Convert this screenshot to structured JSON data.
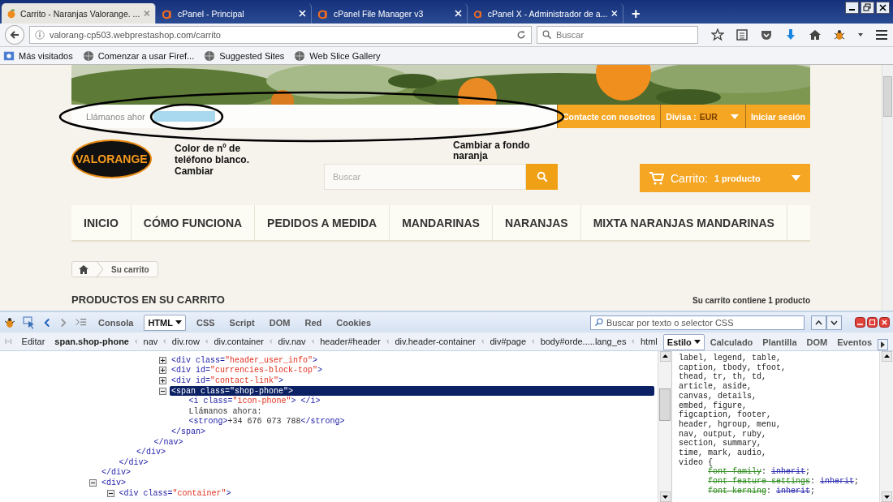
{
  "browser": {
    "tabs": [
      {
        "title": "Carrito - Naranjas Valorange. ...",
        "selected": true,
        "kind": "site"
      },
      {
        "title": "cPanel - Principal",
        "selected": false,
        "kind": "cpanel"
      },
      {
        "title": "cPanel File Manager v3",
        "selected": false,
        "kind": "cpanel"
      },
      {
        "title": "cPanel X - Administrador de a...",
        "selected": false,
        "kind": "cpanel"
      }
    ],
    "new_tab": "+",
    "url": "valorang-cp503.webprestashop.com/carrito",
    "search_placeholder": "Buscar",
    "bookmarks": [
      {
        "label": "Más visitados",
        "kind": "folder"
      },
      {
        "label": "Comenzar a usar Firef...",
        "kind": "globe"
      },
      {
        "label": "Suggested Sites",
        "kind": "globe"
      },
      {
        "label": "Web Slice Gallery",
        "kind": "globe"
      }
    ]
  },
  "page": {
    "phone_label": "Llámanos ahor",
    "top_links": [
      {
        "label": "Contacte con nosotros",
        "kind": "link"
      },
      {
        "label": "Divisa :",
        "value": "EUR",
        "kind": "dropdown"
      },
      {
        "label": "Iniciar sesión",
        "kind": "link"
      }
    ],
    "logo": "VALORANGE",
    "search_placeholder": "Buscar",
    "cart": {
      "label": "Carrito:",
      "count": "1 producto"
    },
    "menu": [
      "INICIO",
      "CÓMO FUNCIONA",
      "PEDIDOS A MEDIDA",
      "MANDARINAS",
      "NARANJAS",
      "MIXTA NARANJAS MANDARINAS"
    ],
    "breadcrumb": "Su carrito",
    "heading": "PRODUCTOS EN SU CARRITO",
    "summary": "Su carrito contiene 1 producto"
  },
  "annotations": [
    {
      "text": "Color de nº de teléfono blanco. Cambiar"
    },
    {
      "text": "Cambiar a fondo naranja"
    }
  ],
  "devtools": {
    "tabs": [
      {
        "label": "Consola",
        "selected": false
      },
      {
        "label": "HTML",
        "selected": true
      },
      {
        "label": "CSS",
        "selected": false
      },
      {
        "label": "Script",
        "selected": false
      },
      {
        "label": "DOM",
        "selected": false
      },
      {
        "label": "Red",
        "selected": false
      },
      {
        "label": "Cookies",
        "selected": false
      }
    ],
    "search_placeholder": "Buscar por texto o selector CSS",
    "edit": "Editar",
    "path": [
      "span.shop-phone",
      "nav",
      "div.row",
      "div.container",
      "div.nav",
      "header#header",
      "div.header-container",
      "div#page",
      "body#orde.....lang_es",
      "html"
    ],
    "side_tabs": [
      {
        "label": "Estilo",
        "selected": true
      },
      {
        "label": "Calculado",
        "selected": false
      },
      {
        "label": "Plantilla",
        "selected": false
      },
      {
        "label": "DOM",
        "selected": false
      },
      {
        "label": "Eventos",
        "selected": false
      }
    ],
    "tree": [
      {
        "kind": "element",
        "close": "</div>",
        "children": [
          {
            "kind": "element",
            "close": "</div>",
            "children": [
              {
                "kind": "element",
                "close": "</div>",
                "children": [
                  {
                    "kind": "element",
                    "close": "</nav>",
                    "children": [
                      {
                        "kind": "element",
                        "tokens": [
                          {
                            "kind": "tag",
                            "s": "<div"
                          },
                          {
                            "kind": "attr",
                            "s": " class="
                          },
                          {
                            "kind": "value",
                            "s": "\"header_user_info\""
                          },
                          {
                            "kind": "tag",
                            "s": ">"
                          }
                        ],
                        "expanded": false,
                        "selected": false
                      },
                      {
                        "kind": "element",
                        "tokens": [
                          {
                            "kind": "tag",
                            "s": "<div"
                          },
                          {
                            "kind": "attr",
                            "s": " id="
                          },
                          {
                            "kind": "value",
                            "s": "\"currencies-block-top\""
                          },
                          {
                            "kind": "tag",
                            "s": ">"
                          }
                        ],
                        "expanded": false,
                        "selected": false
                      },
                      {
                        "kind": "element",
                        "tokens": [
                          {
                            "kind": "tag",
                            "s": "<div"
                          },
                          {
                            "kind": "attr",
                            "s": " id="
                          },
                          {
                            "kind": "value",
                            "s": "\"contact-link\""
                          },
                          {
                            "kind": "tag",
                            "s": ">"
                          }
                        ],
                        "expanded": false,
                        "selected": false
                      },
                      {
                        "kind": "element",
                        "tokens": [
                          {
                            "kind": "tag",
                            "s": "<span"
                          },
                          {
                            "kind": "attr",
                            "s": " class="
                          },
                          {
                            "kind": "value",
                            "s": "\"shop-phone\""
                          },
                          {
                            "kind": "tag",
                            "s": ">"
                          }
                        ],
                        "expanded": true,
                        "selected": true,
                        "close": "</span>",
                        "children": [
                          {
                            "kind": "leaf",
                            "tokens": [
                              {
                                "kind": "tag",
                                "s": "<i"
                              },
                              {
                                "kind": "attr",
                                "s": " class="
                              },
                              {
                                "kind": "value",
                                "s": "\"icon-phone\""
                              },
                              {
                                "kind": "tag",
                                "s": "> </i>"
                              }
                            ]
                          },
                          {
                            "kind": "text",
                            "text": "Llámanos ahora:"
                          },
                          {
                            "kind": "leaf",
                            "tokens": [
                              {
                                "kind": "tag",
                                "s": "<strong>"
                              },
                              {
                                "kind": "text",
                                "s": "+34 676 073 788"
                              },
                              {
                                "kind": "tag",
                                "s": "</strong>"
                              }
                            ]
                          }
                        ]
                      }
                    ]
                  }
                ]
              }
            ]
          }
        ]
      },
      {
        "kind": "element",
        "tokens": [
          {
            "kind": "tag",
            "s": "<div>"
          }
        ],
        "expanded": true,
        "selected": false,
        "children": [
          {
            "kind": "element",
            "tokens": [
              {
                "kind": "tag",
                "s": "<div"
              },
              {
                "kind": "attr",
                "s": " class="
              },
              {
                "kind": "value",
                "s": "\"container\""
              },
              {
                "kind": "tag",
                "s": ">"
              }
            ],
            "expanded": true,
            "selected": false
          }
        ]
      }
    ],
    "css": [
      {
        "kind": "selector",
        "text": "label, legend, table,"
      },
      {
        "kind": "selector",
        "text": "caption, tbody, tfoot,"
      },
      {
        "kind": "selector",
        "text": "thead, tr, th, td,"
      },
      {
        "kind": "selector",
        "text": "article, aside,"
      },
      {
        "kind": "selector",
        "text": "canvas, details,"
      },
      {
        "kind": "selector",
        "text": "embed, figure,"
      },
      {
        "kind": "selector",
        "text": "figcaption, footer,"
      },
      {
        "kind": "selector",
        "text": "header, hgroup, menu,"
      },
      {
        "kind": "selector",
        "text": "nav, output, ruby,"
      },
      {
        "kind": "selector",
        "text": "section, summary,"
      },
      {
        "kind": "selector",
        "text": "time, mark, audio,"
      },
      {
        "kind": "selector",
        "text": "video {"
      },
      {
        "kind": "property",
        "name": "font-family",
        "sep": ": ",
        "value": "inherit",
        "end": ";",
        "overridden": true
      },
      {
        "kind": "property",
        "name": "font-feature-settings",
        "sep": ": ",
        "value": "inherit",
        "end": ";",
        "overridden": true
      },
      {
        "kind": "property",
        "name": "font-kerning",
        "sep": ": ",
        "value": "inherit",
        "end": ";",
        "overridden": true
      }
    ]
  }
}
